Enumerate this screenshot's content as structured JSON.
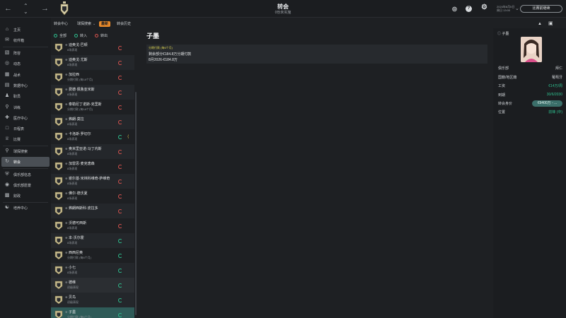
{
  "topbar": {
    "title": "转会",
    "subtitle": "0份未实施",
    "date_line1": "2024年8月5日",
    "date_line2": "周日 13:00",
    "continue_label": "比赛前继续",
    "help_label": "?"
  },
  "leftnav": {
    "items": [
      {
        "label": "主页",
        "icon": "home-icon"
      },
      {
        "label": "收件箱",
        "icon": "inbox-icon"
      },
      {
        "label": "阵容",
        "icon": "squad-icon"
      },
      {
        "label": "动态",
        "icon": "dynamics-icon"
      },
      {
        "label": "战术",
        "icon": "tactics-icon"
      },
      {
        "label": "数据中心",
        "icon": "data-hub-icon"
      },
      {
        "label": "职员",
        "icon": "staff-icon"
      },
      {
        "label": "训练",
        "icon": "training-icon"
      },
      {
        "label": "医疗中心",
        "icon": "medical-icon"
      },
      {
        "label": "日程表",
        "icon": "schedule-icon"
      },
      {
        "label": "比赛",
        "icon": "competitions-icon"
      },
      {
        "label": "球探搜索",
        "icon": "scouting-icon"
      },
      {
        "label": "转会",
        "icon": "transfers-icon"
      },
      {
        "label": "俱乐部信息",
        "icon": "club-info-icon"
      },
      {
        "label": "俱乐部愿景",
        "icon": "club-vision-icon"
      },
      {
        "label": "财政",
        "icon": "finances-icon"
      },
      {
        "label": "培养中心",
        "icon": "development-icon"
      }
    ]
  },
  "subnav": {
    "items": [
      "转会中心",
      "球探搜索",
      "最新",
      "转会历史"
    ]
  },
  "filters": {
    "all": "全部",
    "incoming": "转入",
    "outgoing": "转出"
  },
  "list": [
    {
      "name": "迪奥戈·巴顿",
      "stat": "8场表现",
      "status": "red",
      "extra": ""
    },
    {
      "name": "迪奥戈·尤斯",
      "stat": "8场表现",
      "status": "red",
      "extra": ""
    },
    {
      "name": "加拉西",
      "stat": "分期付款 (每18个月)",
      "status": "red",
      "extra": ""
    },
    {
      "name": "费德·佩鲁亚米斯",
      "stat": "8场表现",
      "status": "red",
      "extra": ""
    },
    {
      "name": "泰勒尼丁诺斯-克里斯",
      "stat": "分期付款 (每18个月)",
      "status": "red",
      "extra": ""
    },
    {
      "name": "弗朗·莫拉",
      "stat": "8场表现",
      "status": "red",
      "extra": ""
    },
    {
      "name": "卡洛斯·罗切尔",
      "stat": "8场表现",
      "status": "green",
      "extra": "⟨"
    },
    {
      "name": "奥米里亚诺·马丁内斯",
      "stat": "8场表现",
      "status": "red",
      "extra": ""
    },
    {
      "name": "加雷思·麦克唐森",
      "stat": "8场表现",
      "status": "red",
      "extra": ""
    },
    {
      "name": "谢尔基·米林科维奇-萨维奇",
      "stat": "8场表现",
      "status": "red",
      "extra": ""
    },
    {
      "name": "佛尔·德沃夏",
      "stat": "8场表现",
      "status": "red",
      "extra": ""
    },
    {
      "name": "弗朗西斯科·皮拉多",
      "stat": "",
      "status": "red",
      "extra": ""
    },
    {
      "name": "沃德可西斯",
      "stat": "8场表现",
      "status": "red",
      "extra": ""
    },
    {
      "name": "本·沃尔霍",
      "stat": "8场表现",
      "status": "green",
      "extra": ""
    },
    {
      "name": "西西尼奥",
      "stat": "分期付款 (每6个月)",
      "status": "green",
      "extra": ""
    },
    {
      "name": "小七",
      "stat": "8场表现",
      "status": "green",
      "extra": ""
    },
    {
      "name": "德维",
      "stat": "初级表现",
      "status": "green",
      "extra": ""
    },
    {
      "name": "贝鸟",
      "stat": "初级表现",
      "status": "green",
      "extra": ""
    },
    {
      "name": "子墨",
      "stat": "分期付款 (每6个月)",
      "status": "green",
      "extra": ""
    }
  ],
  "detail": {
    "title": "子墨",
    "type": "分期付款 (每6个月)",
    "line1": "剩余部分€184.8万分期付款",
    "line2": "8月2026-€184.8万"
  },
  "profile": {
    "name": "子墨",
    "rows": [
      {
        "label": "俱乐部",
        "value": "拜仁"
      },
      {
        "label": "国籍/地区籍",
        "value": "葡萄牙"
      },
      {
        "label": "工资",
        "value": "€14万/周"
      },
      {
        "label": "到期",
        "value": "30/6/2030"
      },
      {
        "label": "转会身价",
        "value": "€9400万 - ..."
      },
      {
        "label": "位置",
        "value": "前锋 (中)"
      }
    ]
  },
  "colors": {
    "accent": "#e8892a",
    "selected_row": "#2f5b58",
    "status_red": "#d9534f",
    "status_green": "#2ec08f",
    "detail_type": "#d8d04f"
  }
}
